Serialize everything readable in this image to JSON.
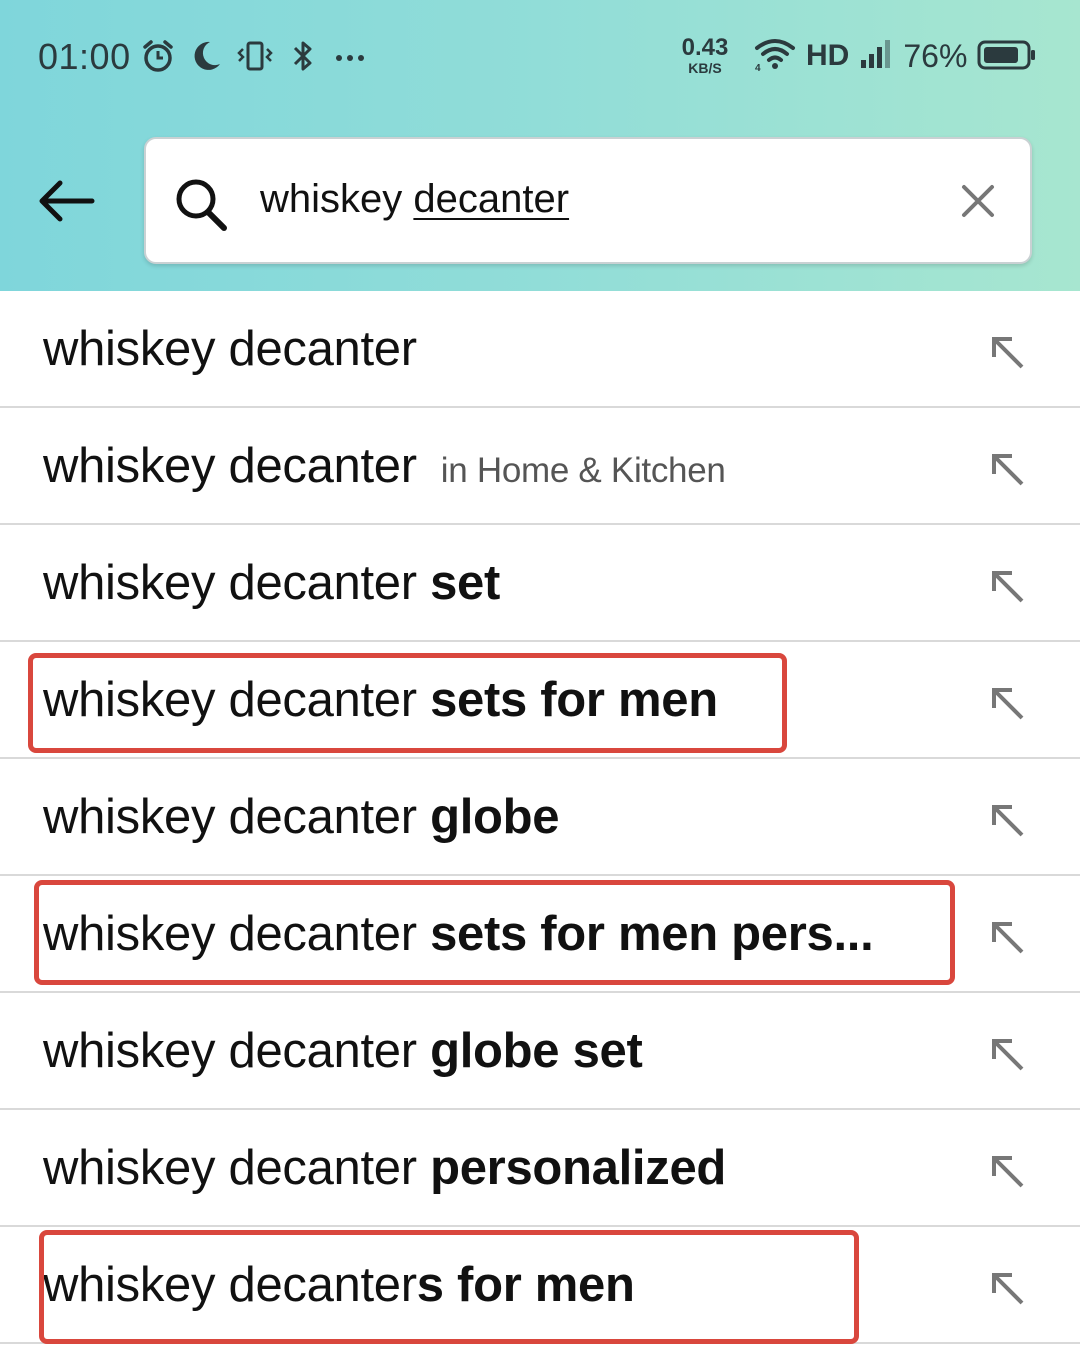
{
  "status_bar": {
    "time": "01:00",
    "net_speed_value": "0.43",
    "net_speed_unit": "KB/S",
    "network_label": "HD",
    "battery_percent": "76%",
    "icons_left": [
      "alarm-icon",
      "moon-icon",
      "vibrate-icon",
      "bluetooth-icon",
      "more-dots-icon"
    ],
    "icons_right": [
      "wifi-icon",
      "signal-icon",
      "battery-icon"
    ]
  },
  "search": {
    "query_plain": "whiskey ",
    "query_underlined": "decanter"
  },
  "suggestions": [
    {
      "prefix": "whiskey decanter",
      "suffix": "",
      "department": ""
    },
    {
      "prefix": "whiskey decanter",
      "suffix": "",
      "department": "in Home & Kitchen"
    },
    {
      "prefix": "whiskey decanter ",
      "suffix": "set",
      "department": ""
    },
    {
      "prefix": "whiskey decanter ",
      "suffix": "sets for men",
      "department": ""
    },
    {
      "prefix": "whiskey decanter ",
      "suffix": "globe",
      "department": ""
    },
    {
      "prefix": "whiskey decanter ",
      "suffix": "sets for men pers...",
      "department": ""
    },
    {
      "prefix": "whiskey decanter ",
      "suffix": "globe set",
      "department": ""
    },
    {
      "prefix": "whiskey decanter ",
      "suffix": "personalized",
      "department": ""
    },
    {
      "prefix": "whiskey decanter",
      "suffix": "s for men",
      "department": ""
    }
  ],
  "colors": {
    "highlight_border": "#d9473d",
    "header_gradient_start": "#7fd6db",
    "header_gradient_end": "#a7e6d0"
  }
}
